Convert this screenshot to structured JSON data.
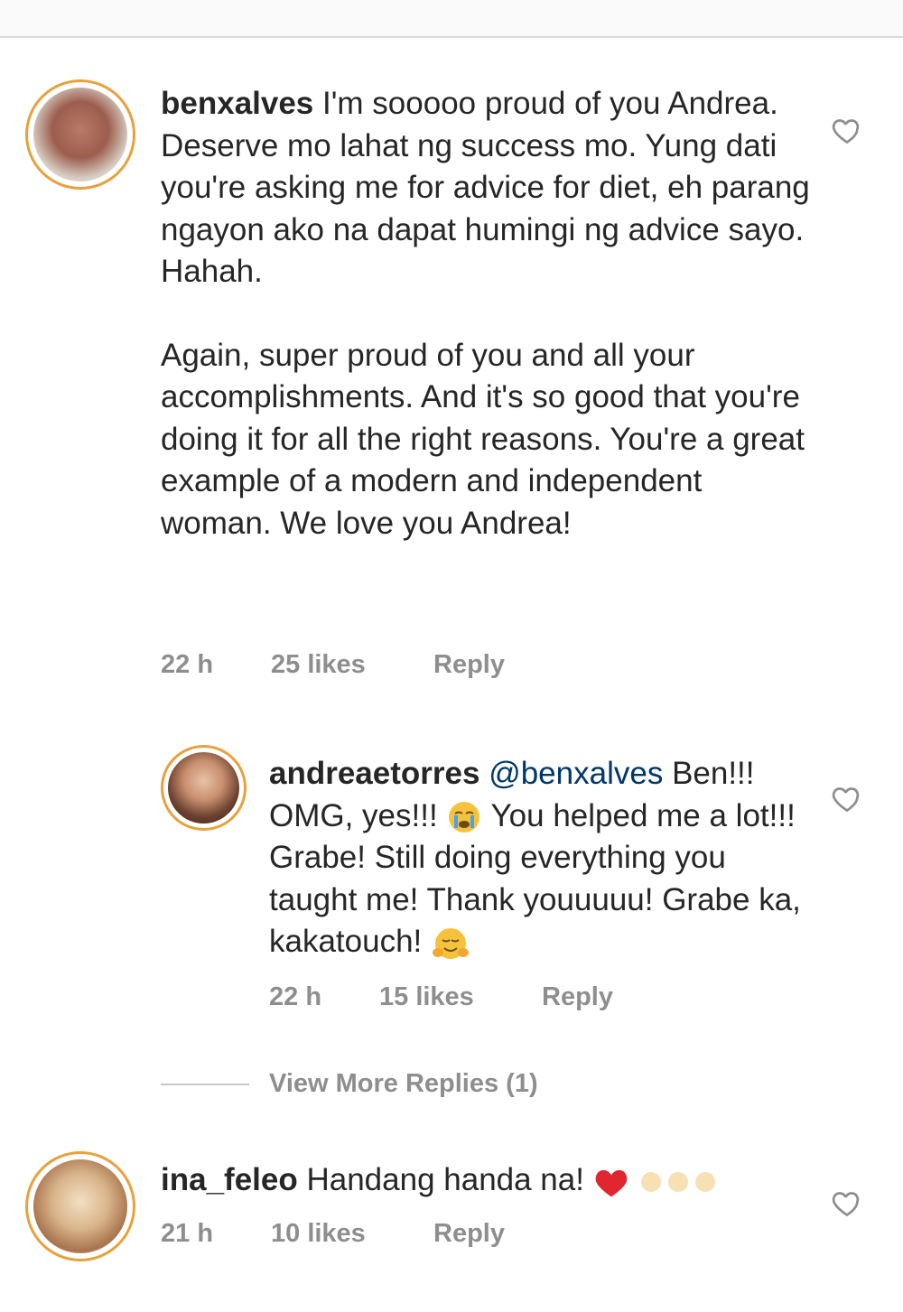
{
  "comments": [
    {
      "username": "benxalves",
      "text_first": "I'm sooooo proud of you Andrea.",
      "text_second": "Deserve mo lahat ng success mo. Yung dati you're asking me for advice for diet, eh parang ngayon ako na dapat humingi ng advice sayo. Hahah.",
      "text_third": "Again, super proud of you and all your accomplishments. And it's so good that you're doing it for all the right reasons. You're a great example of a modern and independent woman. We love you Andrea!",
      "time": "22 h",
      "likes": "25 likes",
      "reply_label": "Reply"
    },
    {
      "username": "andreaetorres",
      "mention": "@benxalves",
      "text_a": "Ben!!! OMG, yes!!!",
      "text_b": "You helped me a lot!!! Grabe! Still doing everything you taught me! Thank youuuuu! Grabe ka, kakatouch!",
      "time": "22 h",
      "likes": "15 likes",
      "reply_label": "Reply"
    },
    {
      "username": "ina_feleo",
      "text": "Handang handa na!",
      "time": "21 h",
      "likes": "10 likes",
      "reply_label": "Reply"
    }
  ],
  "view_more_replies": "View More Replies (1)",
  "colors": {
    "avatar_ring": "#e8a13c",
    "muted_text": "#8e8e8e",
    "mention": "#00376b",
    "heart_red": "#e0262f"
  },
  "icons": {
    "like": "heart-outline-icon",
    "crying_emoji": "loudly-crying-face-icon",
    "hug_emoji": "smiling-face-icon",
    "red_heart": "red-heart-icon"
  }
}
